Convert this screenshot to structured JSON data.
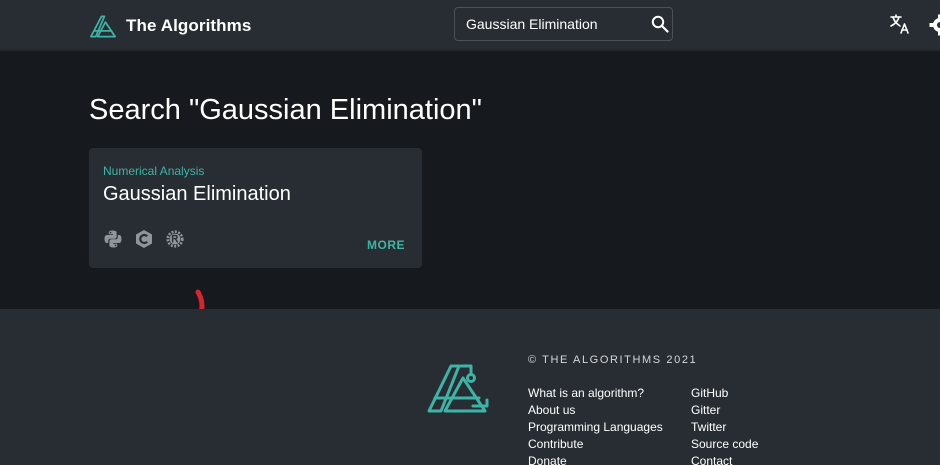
{
  "header": {
    "brand": "The Algorithms",
    "search": {
      "value": "Gaussian Elimination",
      "placeholder": ""
    },
    "icons": [
      "logo-icon",
      "search-icon",
      "translate-icon",
      "settings-gear-icon"
    ]
  },
  "main": {
    "title": "Search \"Gaussian Elimination\"",
    "result": {
      "category": "Numerical Analysis",
      "title": "Gaussian Elimination",
      "languages": [
        "python-icon",
        "c-language-icon",
        "rust-icon"
      ],
      "more_label": "MORE"
    }
  },
  "footer": {
    "copyright": "© THE ALGORITHMS 2021",
    "links_col1": [
      "What is an algorithm?",
      "About us",
      "Programming Languages",
      "Contribute",
      "Donate"
    ],
    "links_col2": [
      "GitHub",
      "Gitter",
      "Twitter",
      "Source code",
      "Contact"
    ]
  },
  "colors": {
    "header_bg": "#272d32",
    "main_bg": "#16191d",
    "card_bg": "#272d32",
    "accent": "#3eb4a7",
    "scribble": "#d7262b"
  }
}
